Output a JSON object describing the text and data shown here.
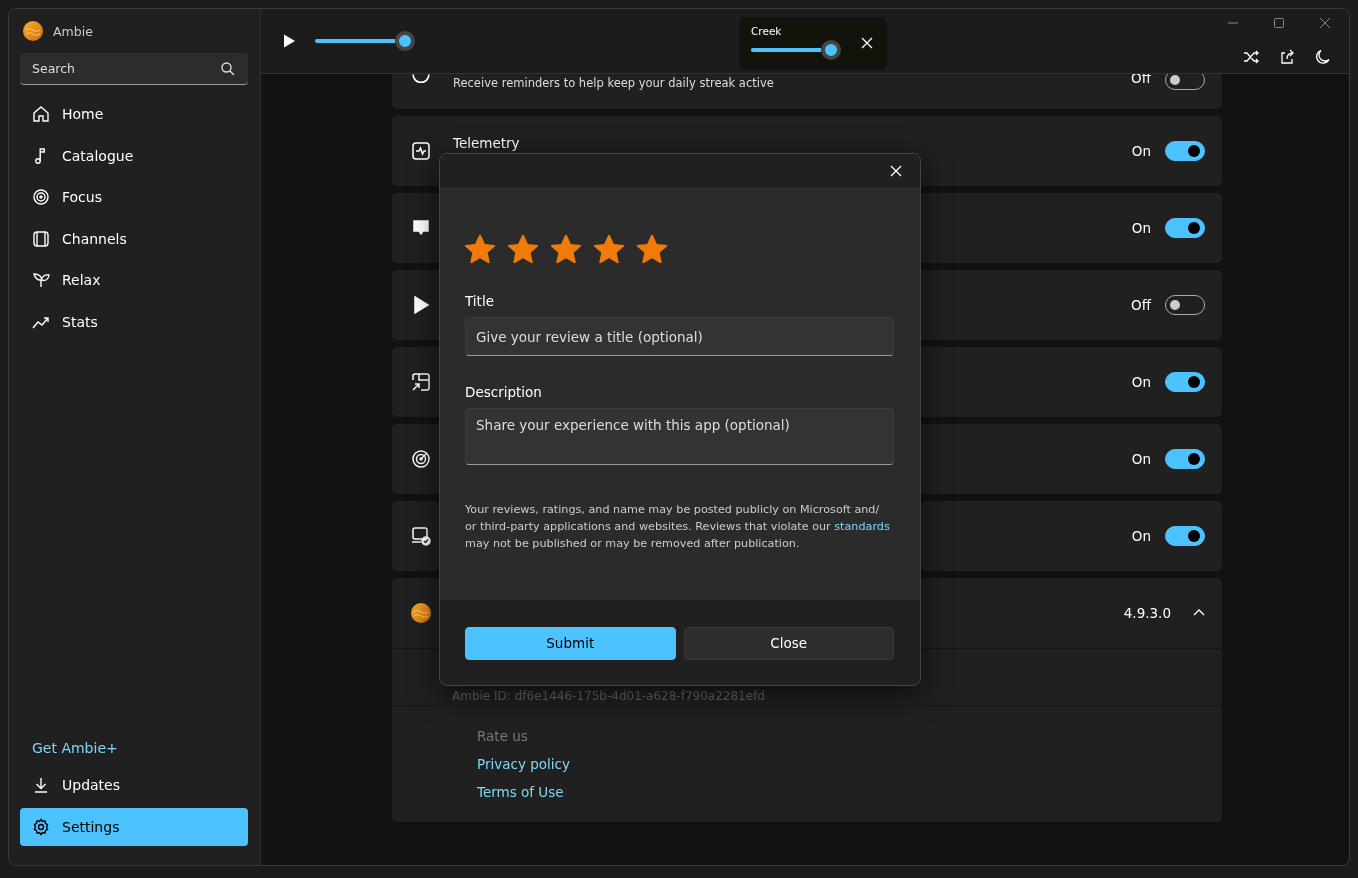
{
  "app": {
    "title": "Ambie"
  },
  "sidebar": {
    "search": {
      "placeholder": "Search"
    },
    "items": [
      {
        "label": "Home",
        "selected": false
      },
      {
        "label": "Catalogue",
        "selected": false
      },
      {
        "label": "Focus",
        "selected": false
      },
      {
        "label": "Channels",
        "selected": false
      },
      {
        "label": "Relax",
        "selected": false
      },
      {
        "label": "Stats",
        "selected": false
      }
    ],
    "promo_link": "Get Ambie+",
    "bottom_items": [
      {
        "label": "Updates",
        "selected": false
      },
      {
        "label": "Settings",
        "selected": true
      }
    ]
  },
  "player": {
    "volume": {
      "level": 1
    },
    "active_sound": {
      "name": "Creek",
      "level": 1
    }
  },
  "settings": [
    {
      "description": "Receive reminders to help keep your daily streak active",
      "state": "Off",
      "on": false
    },
    {
      "title": "Telemetry",
      "state": "On",
      "on": true
    },
    {
      "state": "On",
      "on": true
    },
    {
      "state": "Off",
      "on": false
    },
    {
      "state": "On",
      "on": true
    },
    {
      "state": "On",
      "on": true
    },
    {
      "state": "On",
      "on": true
    }
  ],
  "about": {
    "version": "4.9.3.0",
    "expanded": true,
    "ambie_id": "Ambie ID: df6e1446-175b-4d01-a628-f790a2281efd",
    "links": [
      {
        "label": "Rate us",
        "disabled": true
      },
      {
        "label": "Privacy policy",
        "disabled": false
      },
      {
        "label": "Terms of Use",
        "disabled": false
      }
    ]
  },
  "review_dialog": {
    "stars": 5,
    "title_label": "Title",
    "title_field": {
      "placeholder": "Give your review a title (optional)"
    },
    "description_label": "Description",
    "description_field": {
      "placeholder": "Share your experience with this app (optional)"
    },
    "disclaimer": "Your reviews, ratings, and name may be posted publicly on Microsoft and/ or third-party applications and websites. Reviews that violate our",
    "disclaimer_link": "standards",
    "disclaimer_end": "may not be published or may be removed after publication.",
    "buttons": [
      {
        "label": "Submit",
        "kind": "primary"
      },
      {
        "label": "Close",
        "kind": "secondary"
      }
    ]
  }
}
